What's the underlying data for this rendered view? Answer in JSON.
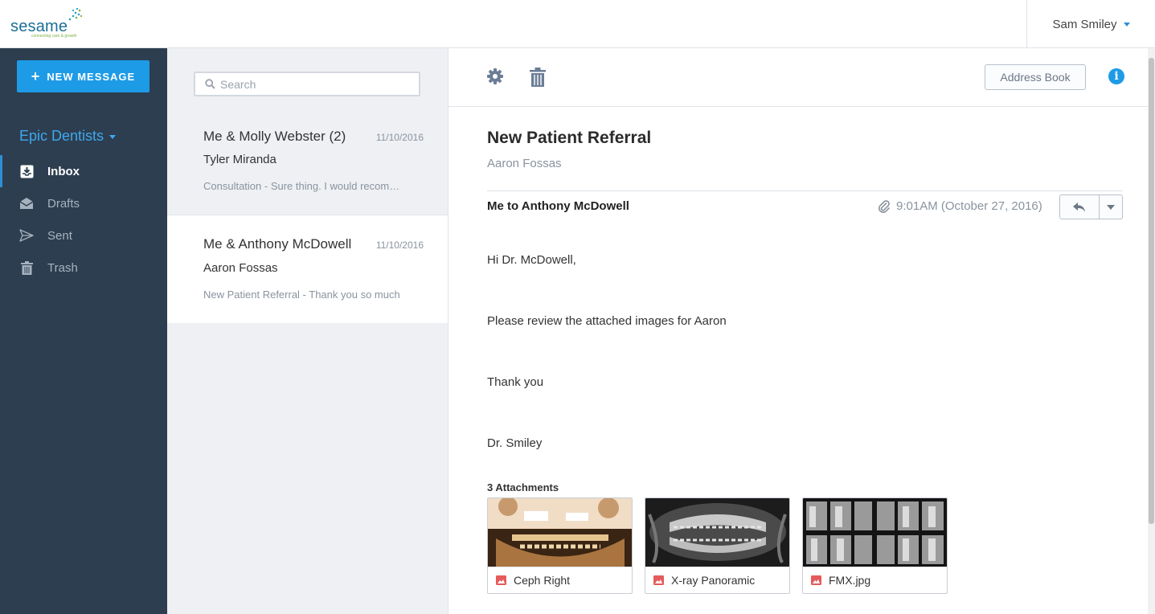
{
  "app": {
    "logo_text": "sesame",
    "logo_tagline": "connecting care & growth"
  },
  "header": {
    "user_name": "Sam Smiley"
  },
  "sidebar": {
    "new_message_label": "NEW MESSAGE",
    "organization": "Epic Dentists",
    "items": [
      {
        "label": "Inbox",
        "icon": "inbox-icon",
        "active": true
      },
      {
        "label": "Drafts",
        "icon": "drafts-icon",
        "active": false
      },
      {
        "label": "Sent",
        "icon": "sent-icon",
        "active": false
      },
      {
        "label": "Trash",
        "icon": "trash-icon",
        "active": false
      }
    ]
  },
  "list": {
    "search_placeholder": "Search",
    "threads": [
      {
        "title": "Me & Molly Webster (2)",
        "date": "11/10/2016",
        "from": "Tyler Miranda",
        "snippet": "Consultation - Sure thing. I would recommend..."
      },
      {
        "title": "Me & Anthony McDowell",
        "date": "11/10/2016",
        "from": "Aaron Fossas",
        "snippet": "New Patient Referral - Thank you so much"
      }
    ]
  },
  "message": {
    "toolbar": {
      "settings_icon": "gear-icon",
      "delete_icon": "trash-icon",
      "address_book_label": "Address Book",
      "info_icon": "info-icon"
    },
    "subject": "New Patient Referral",
    "patient": "Aaron Fossas",
    "participants": "Me to Anthony McDowell",
    "time": "9:01AM (October 27, 2016)",
    "body": [
      "Hi Dr. McDowell,",
      "Please review the attached images for Aaron",
      "Thank you",
      "Dr. Smiley"
    ],
    "attachments_label": "3 Attachments",
    "attachments": [
      {
        "name": "Ceph Right"
      },
      {
        "name": "X-ray Panoramic"
      },
      {
        "name": "FMX.jpg"
      }
    ]
  },
  "colors": {
    "accent": "#1e9be6",
    "sidebar_bg": "#2d3e50",
    "list_bg": "#eef0f4"
  }
}
